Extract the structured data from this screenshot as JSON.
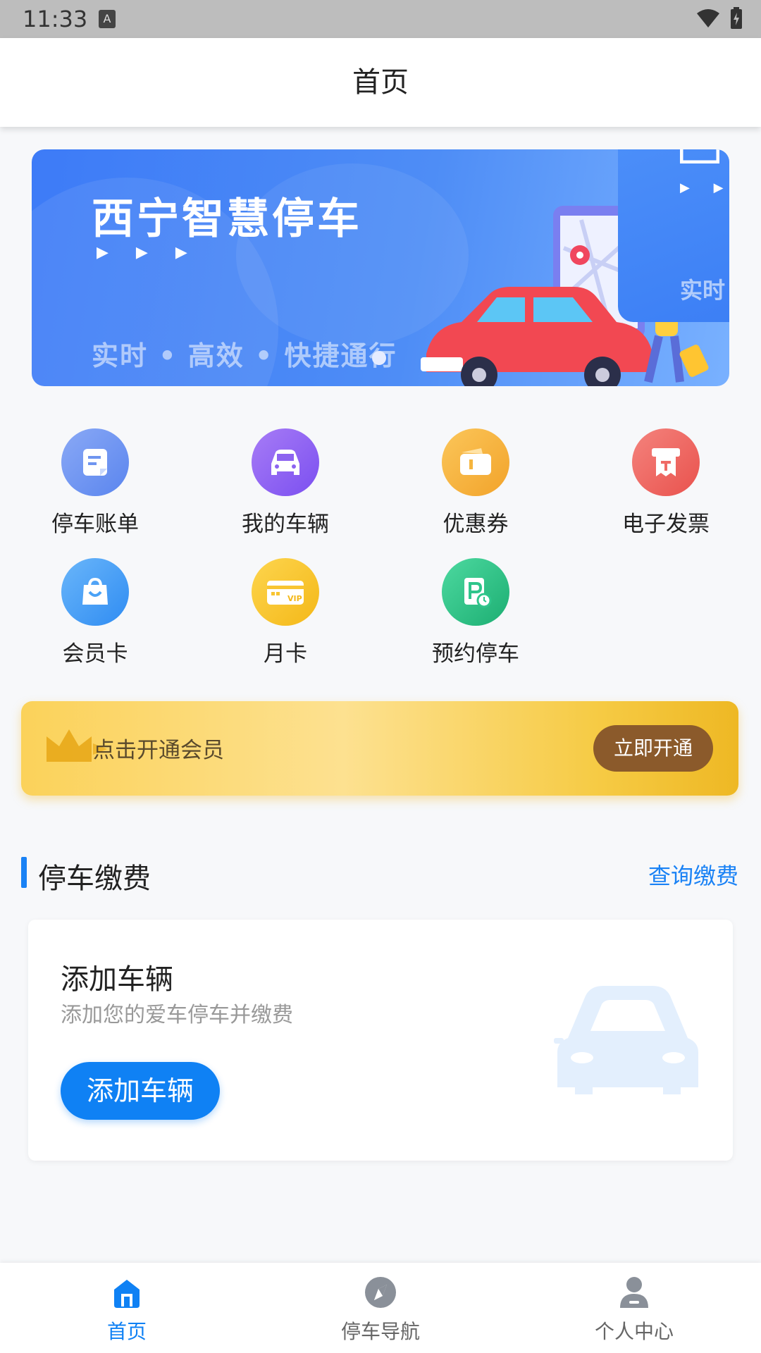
{
  "status_bar": {
    "time": "11:33",
    "a_badge": "A"
  },
  "header": {
    "title": "首页"
  },
  "banner": {
    "title": "西宁智慧停车",
    "arrows": "▶ ▶ ▶",
    "subtitle": "实时 • 高效 • 快捷通行",
    "next_card_text": "实时",
    "next_card_arrows": "▶ ▶"
  },
  "grid": {
    "items": [
      {
        "label": "停车账单",
        "icon": "bill-icon",
        "color": "#6f95f0"
      },
      {
        "label": "我的车辆",
        "icon": "car-icon",
        "color": "#8c63f0"
      },
      {
        "label": "优惠券",
        "icon": "coupon-icon",
        "color": "#f5b53e"
      },
      {
        "label": "电子发票",
        "icon": "invoice-icon",
        "color": "#ef6b66"
      },
      {
        "label": "会员卡",
        "icon": "member-card-icon",
        "color": "#4aa2f6"
      },
      {
        "label": "月卡",
        "icon": "vip-card-icon",
        "color": "#f8c531"
      },
      {
        "label": "预约停车",
        "icon": "reserve-parking-icon",
        "color": "#2fc58b"
      }
    ]
  },
  "vip": {
    "text": "点击开通会员",
    "button": "立即开通"
  },
  "section": {
    "title": "停车缴费",
    "link": "查询缴费"
  },
  "add_vehicle": {
    "title": "添加车辆",
    "subtitle": "添加您的爱车停车并缴费",
    "button": "添加车辆"
  },
  "bottom_nav": {
    "items": [
      {
        "label": "首页",
        "icon": "home-icon",
        "active": true
      },
      {
        "label": "停车导航",
        "icon": "compass-icon",
        "active": false
      },
      {
        "label": "个人中心",
        "icon": "profile-icon",
        "active": false
      }
    ]
  },
  "colors": {
    "accent": "#0f81f4",
    "vip_button": "#8b5a2b"
  }
}
